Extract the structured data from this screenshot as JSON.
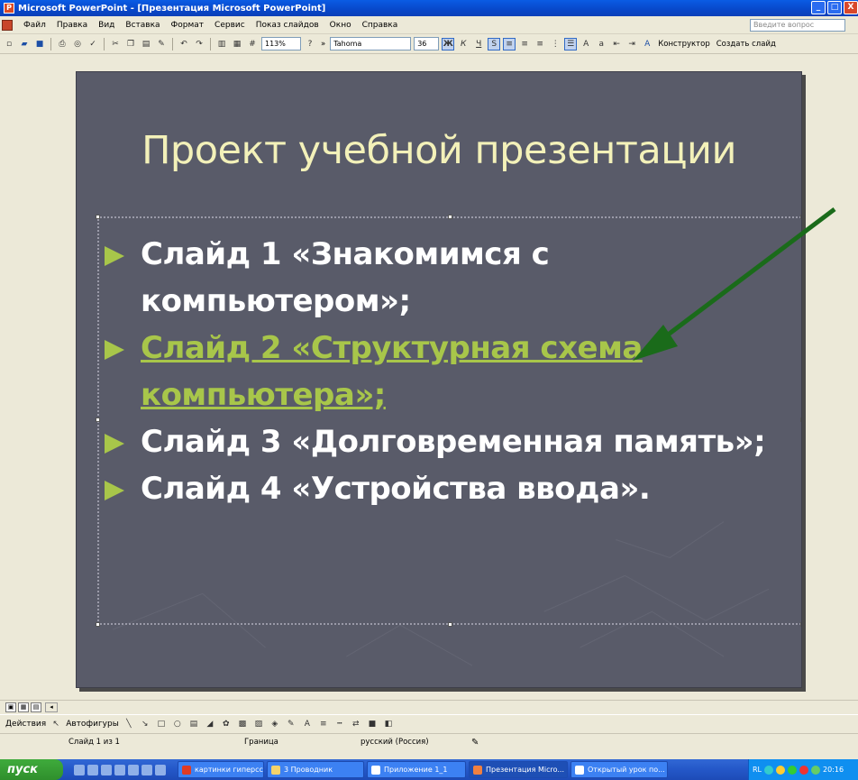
{
  "window": {
    "title": "Microsoft PowerPoint - [Презентация Microsoft PowerPoint]",
    "controls": {
      "minimize": "_",
      "maximize": "□",
      "close": "X"
    }
  },
  "menubar": {
    "items": [
      "Файл",
      "Правка",
      "Вид",
      "Вставка",
      "Формат",
      "Сервис",
      "Показ слайдов",
      "Окно",
      "Справка"
    ],
    "ask_placeholder": "Введите вопрос"
  },
  "toolbar": {
    "zoom": "113%",
    "font": "Tahoma",
    "size": "36",
    "bold": "Ж",
    "italic": "К",
    "underline": "Ч",
    "shadow": "S",
    "designer": "Конструктор",
    "new_slide": "Создать слайд"
  },
  "slide": {
    "title": "Проект учебной презентации",
    "bullets": [
      {
        "text": "Слайд 1 «Знакомимся с компьютером»;",
        "link": false
      },
      {
        "text": "Слайд 2 «Структурная схема компьютера»;",
        "link": true
      },
      {
        "text": "Слайд 3 «Долговременная память»;",
        "link": false
      },
      {
        "text": "Слайд 4 «Устройства ввода».",
        "link": false
      }
    ],
    "colors": {
      "background": "#595b69",
      "title": "#f3f1b9",
      "text": "#ffffff",
      "accent": "#a8c64a",
      "arrow": "#1a6b1a"
    }
  },
  "drawbar": {
    "actions": "Действия",
    "autoshapes": "Автофигуры"
  },
  "statusbar": {
    "slide": "Слайд 1 из 1",
    "design": "Граница",
    "language": "русский (Россия)"
  },
  "taskbar": {
    "start": "пуск",
    "tasks": [
      "картинки гиперсс...",
      "3 Проводник",
      "Приложение 1_1",
      "Презентация Micro...",
      "Открытый урок по..."
    ],
    "tray_lang": "RL",
    "time": "20:16"
  }
}
